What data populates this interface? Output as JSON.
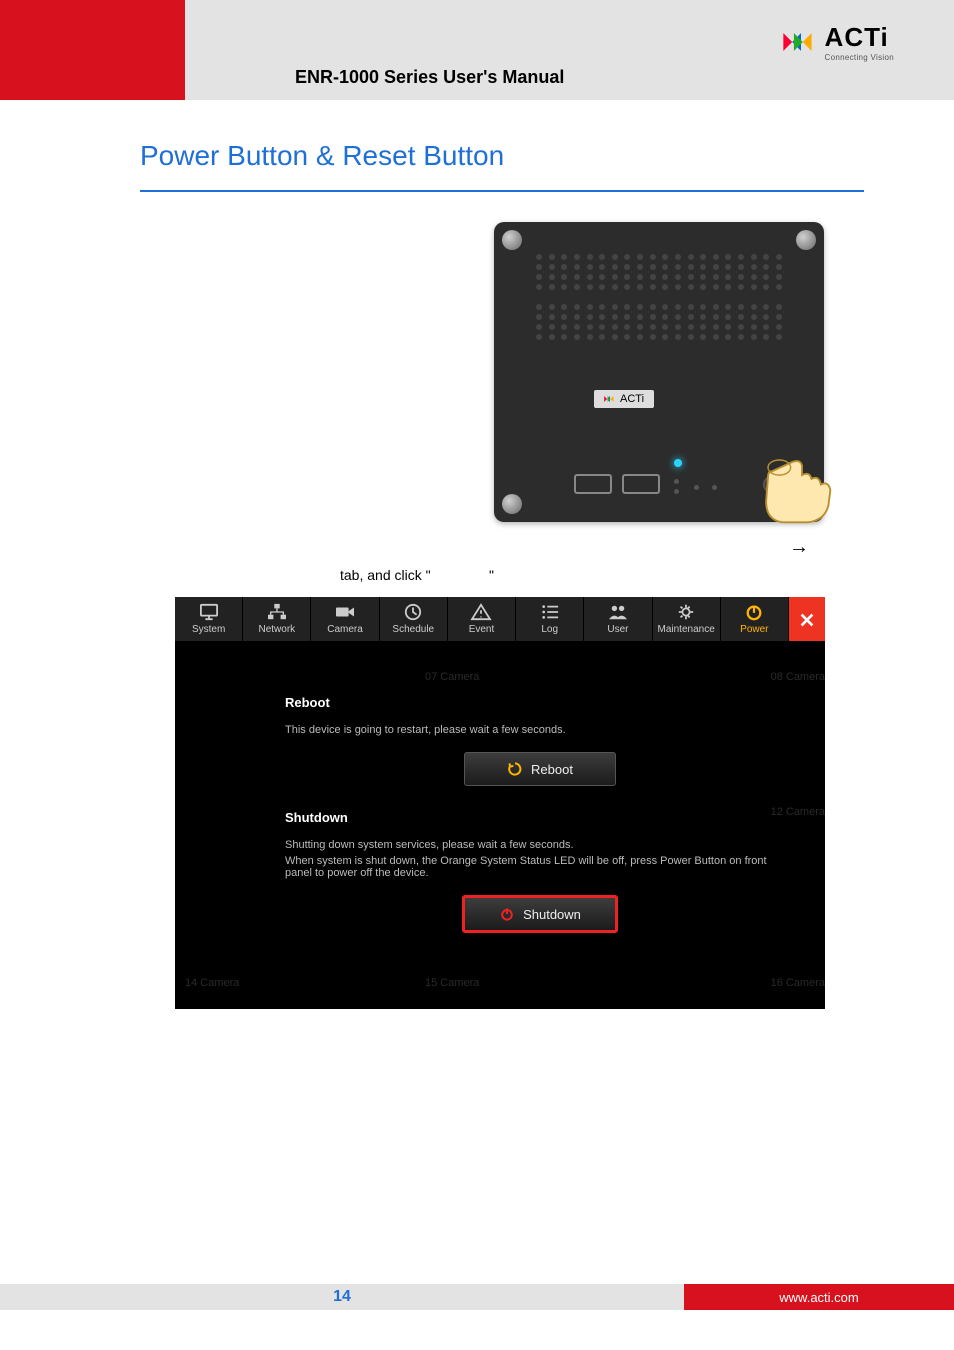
{
  "header": {
    "manual_title": "ENR-1000 Series User's Manual",
    "logo_text": "ACTi",
    "logo_tagline": "Connecting Vision"
  },
  "section_title": "Power Button & Reset Button",
  "device_badge": "ACTi",
  "arrow": "→",
  "text_line2_pre": "tab, and click \"",
  "text_line2_post": "\"",
  "tabs": {
    "items": [
      {
        "label": "System"
      },
      {
        "label": "Network"
      },
      {
        "label": "Camera"
      },
      {
        "label": "Schedule"
      },
      {
        "label": "Event"
      },
      {
        "label": "Log"
      },
      {
        "label": "User"
      },
      {
        "label": "Maintenance"
      },
      {
        "label": "Power"
      }
    ]
  },
  "panel": {
    "reboot": {
      "title": "Reboot",
      "text": "This device is going to restart, please wait a few seconds.",
      "button": "Reboot"
    },
    "shutdown": {
      "title": "Shutdown",
      "text1": "Shutting down system services, please wait a few seconds.",
      "text2": "When system is shut down, the Orange System Status LED will be off, press Power Button on front panel to power off the device.",
      "button": "Shutdown"
    },
    "ghosts": {
      "g1": "07 Camera",
      "g2": "08 Camera",
      "g3": "12 Camera",
      "g4": "14 Camera",
      "g5": "15 Camera",
      "g6": "16 Camera"
    }
  },
  "footer": {
    "page_number": "14",
    "url": "www.acti.com"
  }
}
